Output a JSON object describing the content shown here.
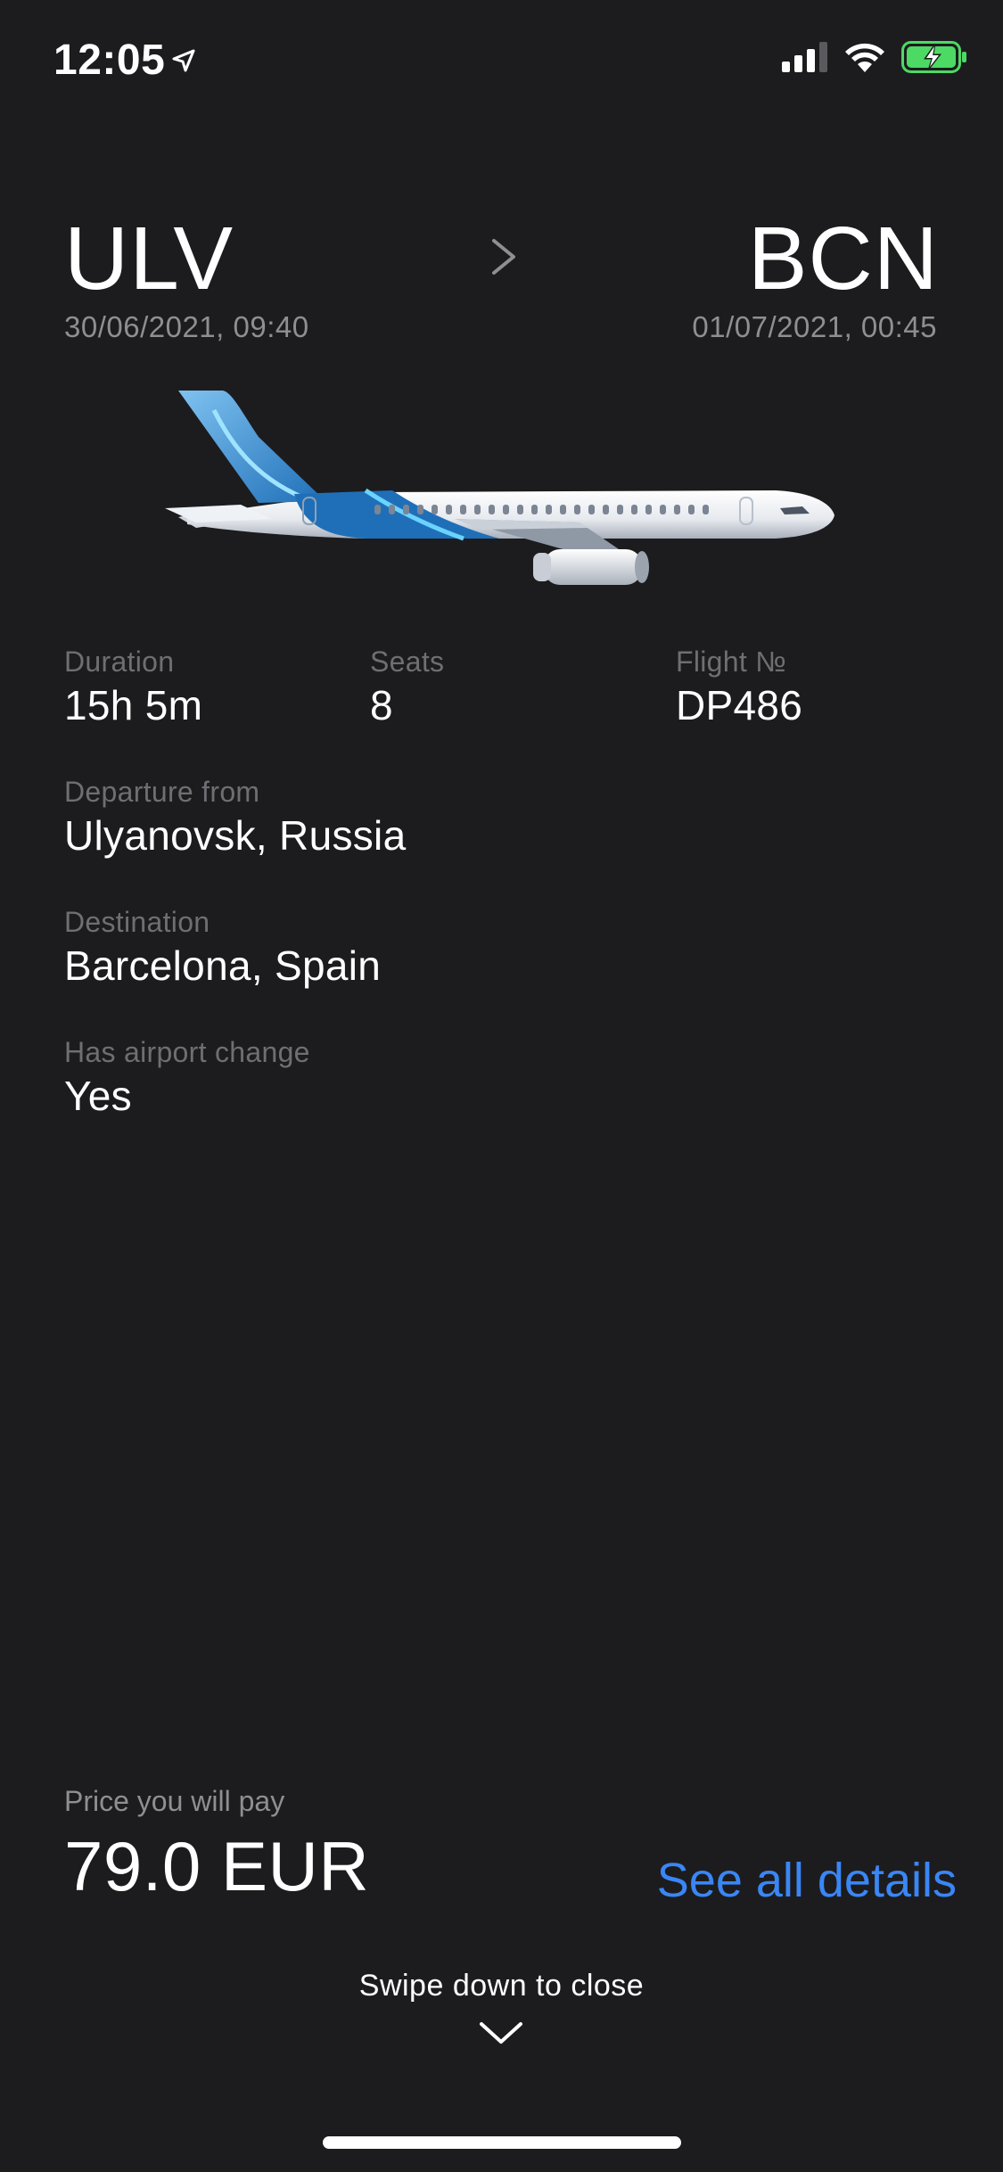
{
  "status_bar": {
    "time": "12:05",
    "icons": [
      "location-arrow-icon",
      "signal-icon",
      "wifi-icon",
      "battery-charging-icon"
    ],
    "battery_color": "#4cd964"
  },
  "route": {
    "origin_code": "ULV",
    "origin_datetime": "30/06/2021, 09:40",
    "dest_code": "BCN",
    "dest_datetime": "01/07/2021, 00:45"
  },
  "info": {
    "duration_label": "Duration",
    "duration_value": "15h 5m",
    "seats_label": "Seats",
    "seats_value": "8",
    "flight_label": "Flight №",
    "flight_value": "DP486",
    "departure_label": "Departure from",
    "departure_value": "Ulyanovsk, Russia",
    "destination_label": "Destination",
    "destination_value": "Barcelona, Spain",
    "airport_change_label": "Has airport change",
    "airport_change_value": "Yes"
  },
  "price": {
    "label": "Price you will pay",
    "value": "79.0 EUR"
  },
  "actions": {
    "see_all_details": "See all details",
    "swipe_hint": "Swipe down to close"
  },
  "colors": {
    "background": "#1c1c1e",
    "accent": "#3a86f5",
    "muted": "#8e8e93"
  }
}
